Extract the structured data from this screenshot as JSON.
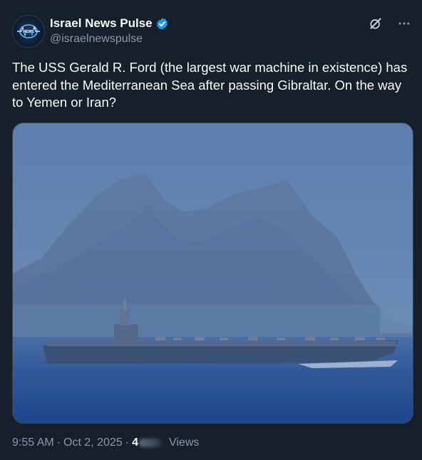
{
  "author": {
    "display_name": "Israel News Pulse",
    "handle": "@israelnewspulse",
    "avatar_text": "ISRAEL NEWS PULSE",
    "verified": true,
    "verified_color": "#1d9bf0"
  },
  "icons": {
    "grok": "grok-icon",
    "more": "more-options-icon",
    "verified": "verified-badge-icon"
  },
  "tweet": {
    "text": "The USS Gerald R. Ford (the largest war machine in existence) has entered the Mediterranean Sea after passing Gibraltar. On the way to Yemen or Iran?",
    "media": "Photo of the USS Gerald R. Ford aircraft carrier sailing in front of the Rock of Gibraltar in blue haze"
  },
  "meta": {
    "time": "9:55 AM",
    "date": "Oct 2, 2025",
    "separator": "·",
    "views_count_visible": "4",
    "views_label": "Views"
  },
  "colors": {
    "background": "#15202b",
    "text_primary": "#f7f9f9",
    "text_secondary": "#8b98a5",
    "accent": "#1d9bf0"
  }
}
